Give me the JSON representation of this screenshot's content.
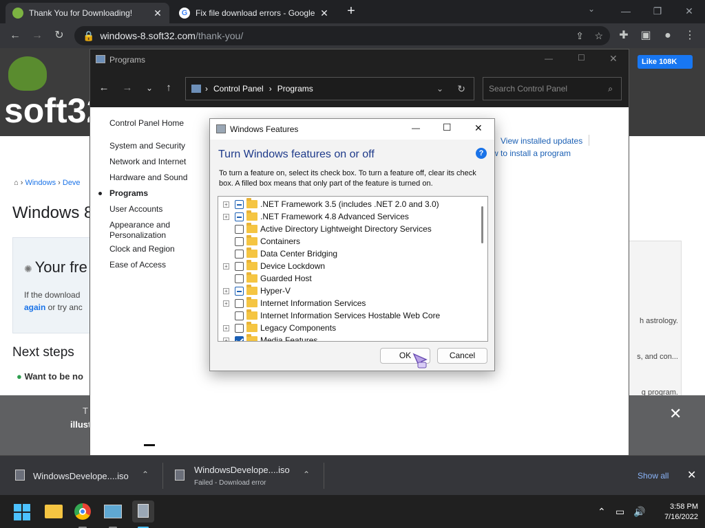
{
  "browser": {
    "tabs": [
      {
        "title": "Thank You for Downloading!",
        "active": true
      },
      {
        "title": "Fix file download errors - Google",
        "active": false
      }
    ],
    "new_tab": "+",
    "url_host": "windows-8.soft32.com",
    "url_path": "/thank-you/",
    "window_min": "—",
    "window_restore": "❐",
    "window_close": "✕"
  },
  "website": {
    "logo": "soft32",
    "fb_like": "Like 108K",
    "crumb_home": "⌂",
    "crumb_windows": "Windows",
    "crumb_dev": "Deve",
    "heading": "Windows 8",
    "free_text": "Your fre",
    "if_download": "If the download",
    "again_link": "again",
    "again_rest": " or try anc",
    "next_steps": "Next steps",
    "want_to_be": "Want to be no",
    "right_snippets": [
      "h astrology.",
      "s, and con...",
      "g program."
    ],
    "overlay_letter_1": "T",
    "overlay_letter_2": "illust"
  },
  "explorer": {
    "title": "Programs",
    "address": [
      "Control Panel",
      "Programs"
    ],
    "search_placeholder": "Search Control Panel",
    "sidebar": [
      {
        "label": "Control Panel Home",
        "current": false
      },
      {
        "label": "System and Security",
        "current": false
      },
      {
        "label": "Network and Internet",
        "current": false
      },
      {
        "label": "Hardware and Sound",
        "current": false
      },
      {
        "label": "Programs",
        "current": true
      },
      {
        "label": "User Accounts",
        "current": false
      },
      {
        "label": "Appearance and",
        "current": false
      },
      {
        "label": "Personalization",
        "current": false
      },
      {
        "label": "Clock and Region",
        "current": false
      },
      {
        "label": "Ease of Access",
        "current": false
      }
    ],
    "links": [
      "View installed updates",
      "w to install a program"
    ]
  },
  "dialog": {
    "title": "Windows Features",
    "heading": "Turn Windows features on or off",
    "help": "?",
    "description": "To turn a feature on, select its check box. To turn a feature off, clear its check box. A filled box means that only part of the feature is turned on.",
    "features": [
      {
        "label": ".NET Framework 3.5 (includes .NET 2.0 and 3.0)",
        "state": "partial",
        "expandable": true
      },
      {
        "label": ".NET Framework 4.8 Advanced Services",
        "state": "partial",
        "expandable": true
      },
      {
        "label": "Active Directory Lightweight Directory Services",
        "state": "unchecked",
        "expandable": false
      },
      {
        "label": "Containers",
        "state": "unchecked",
        "expandable": false
      },
      {
        "label": "Data Center Bridging",
        "state": "unchecked",
        "expandable": false
      },
      {
        "label": "Device Lockdown",
        "state": "unchecked",
        "expandable": true
      },
      {
        "label": "Guarded Host",
        "state": "unchecked",
        "expandable": false
      },
      {
        "label": "Hyper-V",
        "state": "partial",
        "expandable": true
      },
      {
        "label": "Internet Information Services",
        "state": "unchecked",
        "expandable": true
      },
      {
        "label": "Internet Information Services Hostable Web Core",
        "state": "unchecked",
        "expandable": false
      },
      {
        "label": "Legacy Components",
        "state": "unchecked",
        "expandable": true
      },
      {
        "label": "Media Features",
        "state": "checked",
        "expandable": true
      }
    ],
    "ok": "OK",
    "cancel": "Cancel"
  },
  "downloads": [
    {
      "name": "WindowsDevelope....iso",
      "status": ""
    },
    {
      "name": "WindowsDevelope....iso",
      "status": "Failed - Download error"
    }
  ],
  "downloads_show_all": "Show all",
  "clock": {
    "time": "3:58 PM",
    "date": "7/16/2022"
  },
  "colors": {
    "accent": "#1a5fb4",
    "chrome_dark": "#202124",
    "facebook": "#1877f2"
  }
}
